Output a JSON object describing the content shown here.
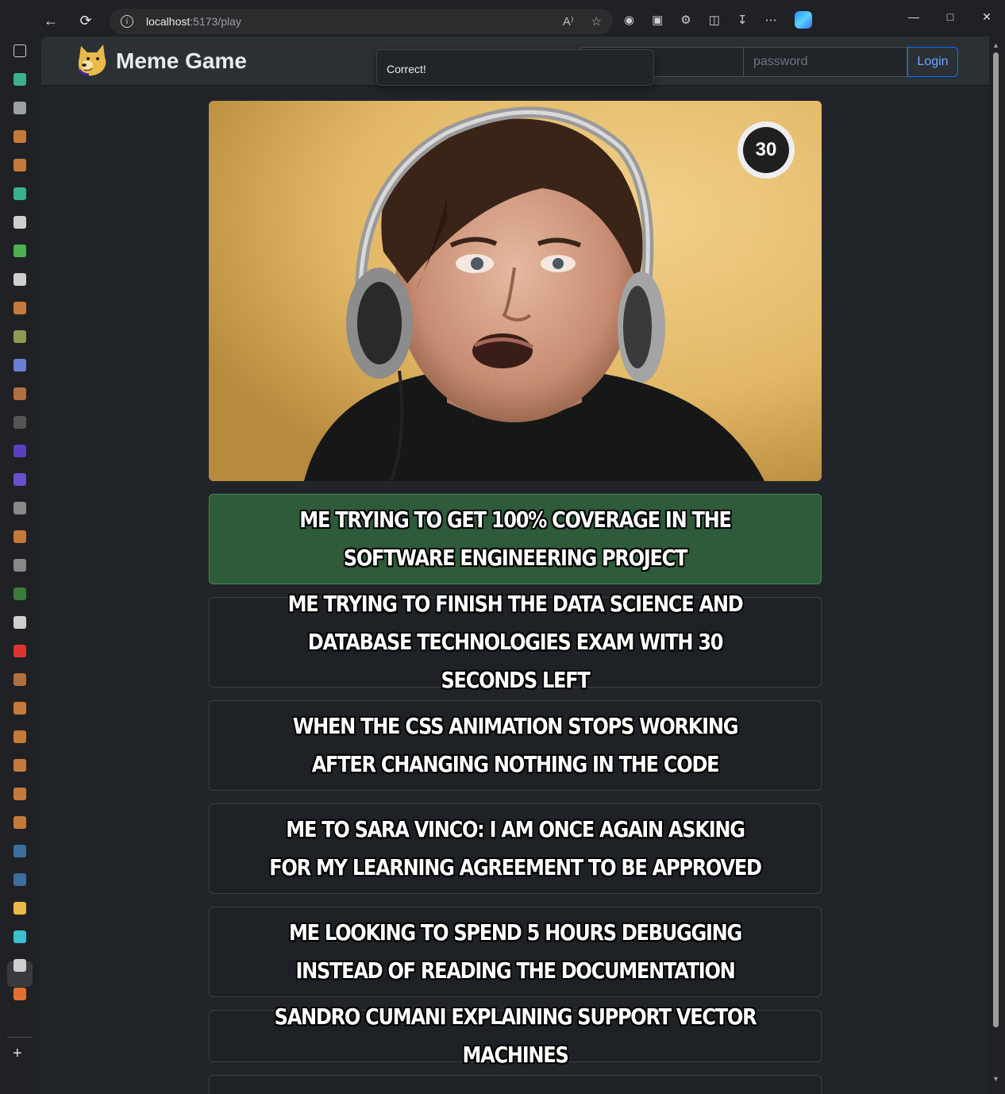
{
  "browser": {
    "url_host": "localhost",
    "url_path": ":5173/play",
    "read_aloud_icon": "read-aloud-icon",
    "favorite_icon": "star-icon"
  },
  "app": {
    "brand": "Meme Game",
    "username_placeholder": "",
    "password_placeholder": "password",
    "login_label": "Login"
  },
  "toast": {
    "message": "Correct!"
  },
  "game": {
    "timer": "30",
    "captions": [
      {
        "text": "Me trying to get 100% coverage in the Software Engineering project",
        "state": "correct"
      },
      {
        "text": "Me trying to finish the Data Science and Database Technologies exam with 30 seconds left",
        "state": "default"
      },
      {
        "text": "When the CSS animation stops working after changing nothing in the code",
        "state": "default"
      },
      {
        "text": "Me to Sara Vinco: I am once again asking for my learning agreement to be approved",
        "state": "default"
      },
      {
        "text": "Me looking to spend 5 hours debugging instead of reading the documentation",
        "state": "default"
      },
      {
        "text": "Sandro Cumani explaining Support Vector Machines",
        "state": "default"
      }
    ]
  },
  "colors": {
    "correct_bg": "#2e5b3a",
    "page_bg": "#212529",
    "login_accent": "#0d6efd"
  }
}
